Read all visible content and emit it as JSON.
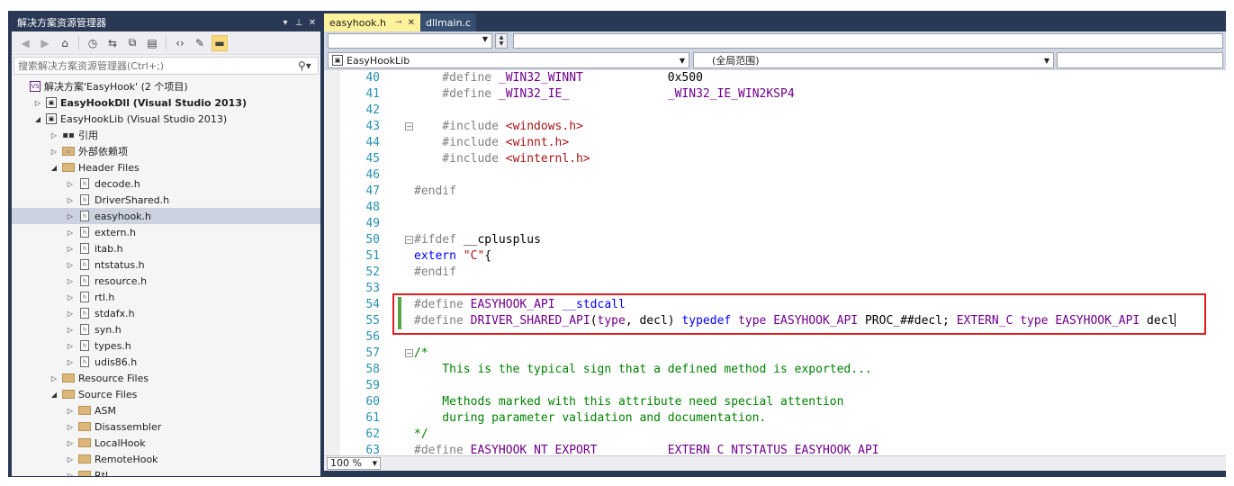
{
  "solution_explorer": {
    "title": "解决方案资源管理器",
    "title_controls": {
      "dropdown": "▾",
      "pin": "⊥",
      "close": "✕"
    },
    "search_placeholder": "搜索解决方案资源管理器(Ctrl+;)",
    "tree": [
      {
        "label": "解决方案'EasyHook' (2 个项目)",
        "depth": 0,
        "expander": "",
        "icon": "solution-icon",
        "bold": false,
        "selected": false
      },
      {
        "label": "EasyHookDll (Visual Studio 2013)",
        "depth": 1,
        "expander": "▷",
        "icon": "project-icon",
        "bold": true,
        "selected": false
      },
      {
        "label": "EasyHookLib (Visual Studio 2013)",
        "depth": 1,
        "expander": "◢",
        "icon": "project-icon",
        "bold": false,
        "selected": false
      },
      {
        "label": "引用",
        "depth": 2,
        "expander": "▷",
        "icon": "references-icon",
        "bold": false,
        "selected": false
      },
      {
        "label": "外部依赖项",
        "depth": 2,
        "expander": "▷",
        "icon": "external-deps-icon",
        "bold": false,
        "selected": false
      },
      {
        "label": "Header Files",
        "depth": 2,
        "expander": "◢",
        "icon": "folder-icon",
        "bold": false,
        "selected": false
      },
      {
        "label": "decode.h",
        "depth": 3,
        "expander": "▷",
        "icon": "header-file-icon",
        "bold": false,
        "selected": false
      },
      {
        "label": "DriverShared.h",
        "depth": 3,
        "expander": "▷",
        "icon": "header-file-icon",
        "bold": false,
        "selected": false
      },
      {
        "label": "easyhook.h",
        "depth": 3,
        "expander": "▷",
        "icon": "header-file-icon",
        "bold": false,
        "selected": true
      },
      {
        "label": "extern.h",
        "depth": 3,
        "expander": "▷",
        "icon": "header-file-icon",
        "bold": false,
        "selected": false
      },
      {
        "label": "itab.h",
        "depth": 3,
        "expander": "▷",
        "icon": "header-file-icon",
        "bold": false,
        "selected": false
      },
      {
        "label": "ntstatus.h",
        "depth": 3,
        "expander": "▷",
        "icon": "header-file-icon",
        "bold": false,
        "selected": false
      },
      {
        "label": "resource.h",
        "depth": 3,
        "expander": "▷",
        "icon": "header-file-icon",
        "bold": false,
        "selected": false
      },
      {
        "label": "rtl.h",
        "depth": 3,
        "expander": "▷",
        "icon": "header-file-icon",
        "bold": false,
        "selected": false
      },
      {
        "label": "stdafx.h",
        "depth": 3,
        "expander": "▷",
        "icon": "header-file-icon",
        "bold": false,
        "selected": false
      },
      {
        "label": "syn.h",
        "depth": 3,
        "expander": "▷",
        "icon": "header-file-icon",
        "bold": false,
        "selected": false
      },
      {
        "label": "types.h",
        "depth": 3,
        "expander": "▷",
        "icon": "header-file-icon",
        "bold": false,
        "selected": false
      },
      {
        "label": "udis86.h",
        "depth": 3,
        "expander": "▷",
        "icon": "header-file-icon",
        "bold": false,
        "selected": false
      },
      {
        "label": "Resource Files",
        "depth": 2,
        "expander": "▷",
        "icon": "folder-icon",
        "bold": false,
        "selected": false
      },
      {
        "label": "Source Files",
        "depth": 2,
        "expander": "◢",
        "icon": "folder-icon",
        "bold": false,
        "selected": false
      },
      {
        "label": "ASM",
        "depth": 3,
        "expander": "▷",
        "icon": "folder-icon",
        "bold": false,
        "selected": false
      },
      {
        "label": "Disassembler",
        "depth": 3,
        "expander": "▷",
        "icon": "folder-icon",
        "bold": false,
        "selected": false
      },
      {
        "label": "LocalHook",
        "depth": 3,
        "expander": "▷",
        "icon": "folder-icon",
        "bold": false,
        "selected": false
      },
      {
        "label": "RemoteHook",
        "depth": 3,
        "expander": "▷",
        "icon": "folder-icon",
        "bold": false,
        "selected": false
      },
      {
        "label": "Rtl",
        "depth": 3,
        "expander": "▷",
        "icon": "folder-icon",
        "bold": false,
        "selected": false
      }
    ]
  },
  "editor": {
    "tabs": [
      {
        "label": "easyhook.h",
        "active": true,
        "pin": "⊸",
        "close": "✕"
      },
      {
        "label": "dllmain.c",
        "active": false
      }
    ],
    "project_dropdown": "EasyHookLib",
    "scope_dropdown": "(全局范围)",
    "zoom": "100 %",
    "highlight_color": "#e02020",
    "lines": [
      {
        "num": "40",
        "fold": "",
        "changed": false,
        "tokens": [
          {
            "t": "    #define ",
            "c": "pp"
          },
          {
            "t": "_WIN32_WINNT",
            "c": "mc"
          },
          {
            "t": "            0x500",
            "c": "nm"
          }
        ]
      },
      {
        "num": "41",
        "fold": "",
        "changed": false,
        "tokens": [
          {
            "t": "    #define ",
            "c": "pp"
          },
          {
            "t": "_WIN32_IE_",
            "c": "mc"
          },
          {
            "t": "              ",
            "c": "nm"
          },
          {
            "t": "_WIN32_IE_WIN2KSP4",
            "c": "mc"
          }
        ]
      },
      {
        "num": "42",
        "fold": "",
        "changed": false,
        "tokens": []
      },
      {
        "num": "43",
        "fold": "⊟",
        "changed": false,
        "tokens": [
          {
            "t": "    #include ",
            "c": "pp"
          },
          {
            "t": "<windows.h>",
            "c": "str"
          }
        ]
      },
      {
        "num": "44",
        "fold": "",
        "changed": false,
        "tokens": [
          {
            "t": "    #include ",
            "c": "pp"
          },
          {
            "t": "<winnt.h>",
            "c": "str"
          }
        ]
      },
      {
        "num": "45",
        "fold": "",
        "changed": false,
        "tokens": [
          {
            "t": "    #include ",
            "c": "pp"
          },
          {
            "t": "<winternl.h>",
            "c": "str"
          }
        ]
      },
      {
        "num": "46",
        "fold": "",
        "changed": false,
        "tokens": []
      },
      {
        "num": "47",
        "fold": "",
        "changed": false,
        "tokens": [
          {
            "t": "#endif",
            "c": "pp"
          }
        ]
      },
      {
        "num": "48",
        "fold": "",
        "changed": false,
        "tokens": []
      },
      {
        "num": "49",
        "fold": "",
        "changed": false,
        "tokens": []
      },
      {
        "num": "50",
        "fold": "⊟",
        "changed": false,
        "tokens": [
          {
            "t": "#ifdef ",
            "c": "pp"
          },
          {
            "t": "__cplusplus",
            "c": "nm"
          }
        ]
      },
      {
        "num": "51",
        "fold": "",
        "changed": false,
        "tokens": [
          {
            "t": "extern ",
            "c": "kw"
          },
          {
            "t": "\"C\"",
            "c": "str"
          },
          {
            "t": "{",
            "c": "nm"
          }
        ]
      },
      {
        "num": "52",
        "fold": "",
        "changed": false,
        "tokens": [
          {
            "t": "#endif",
            "c": "pp"
          }
        ]
      },
      {
        "num": "53",
        "fold": "",
        "changed": false,
        "tokens": []
      },
      {
        "num": "54",
        "fold": "",
        "changed": true,
        "tokens": [
          {
            "t": "#define ",
            "c": "pp"
          },
          {
            "t": "EASYHOOK_API",
            "c": "mc"
          },
          {
            "t": " ",
            "c": "nm"
          },
          {
            "t": "__stdcall",
            "c": "kw"
          }
        ]
      },
      {
        "num": "55",
        "fold": "",
        "changed": true,
        "caret": true,
        "tokens": [
          {
            "t": "#define ",
            "c": "pp"
          },
          {
            "t": "DRIVER_SHARED_API",
            "c": "mc"
          },
          {
            "t": "(",
            "c": "nm"
          },
          {
            "t": "type",
            "c": "mc"
          },
          {
            "t": ", decl) ",
            "c": "nm"
          },
          {
            "t": "typedef",
            "c": "kw"
          },
          {
            "t": " ",
            "c": "nm"
          },
          {
            "t": "type",
            "c": "mc"
          },
          {
            "t": " ",
            "c": "nm"
          },
          {
            "t": "EASYHOOK_API",
            "c": "mc"
          },
          {
            "t": " PROC_##decl; ",
            "c": "nm"
          },
          {
            "t": "EXTERN_C",
            "c": "mc"
          },
          {
            "t": " ",
            "c": "nm"
          },
          {
            "t": "type",
            "c": "mc"
          },
          {
            "t": " ",
            "c": "nm"
          },
          {
            "t": "EASYHOOK_API",
            "c": "mc"
          },
          {
            "t": " decl",
            "c": "nm"
          }
        ]
      },
      {
        "num": "56",
        "fold": "",
        "changed": false,
        "tokens": []
      },
      {
        "num": "57",
        "fold": "⊟",
        "changed": false,
        "tokens": [
          {
            "t": "/*",
            "c": "cm"
          }
        ]
      },
      {
        "num": "58",
        "fold": "",
        "changed": false,
        "tokens": [
          {
            "t": "    This is the typical sign that a defined method is exported...",
            "c": "cm"
          }
        ]
      },
      {
        "num": "59",
        "fold": "",
        "changed": false,
        "tokens": []
      },
      {
        "num": "60",
        "fold": "",
        "changed": false,
        "tokens": [
          {
            "t": "    Methods marked with this attribute need special attention",
            "c": "cm"
          }
        ]
      },
      {
        "num": "61",
        "fold": "",
        "changed": false,
        "tokens": [
          {
            "t": "    during parameter validation and documentation.",
            "c": "cm"
          }
        ]
      },
      {
        "num": "62",
        "fold": "",
        "changed": false,
        "tokens": [
          {
            "t": "*/",
            "c": "cm"
          }
        ]
      },
      {
        "num": "63",
        "fold": "",
        "changed": false,
        "tokens": [
          {
            "t": "#define ",
            "c": "pp"
          },
          {
            "t": "EASYHOOK_NT_EXPORT",
            "c": "mc"
          },
          {
            "t": "          ",
            "c": "nm"
          },
          {
            "t": "EXTERN_C",
            "c": "mc"
          },
          {
            "t": " ",
            "c": "nm"
          },
          {
            "t": "NTSTATUS",
            "c": "mc"
          },
          {
            "t": " ",
            "c": "nm"
          },
          {
            "t": "EASYHOOK_API",
            "c": "mc"
          }
        ]
      }
    ]
  }
}
